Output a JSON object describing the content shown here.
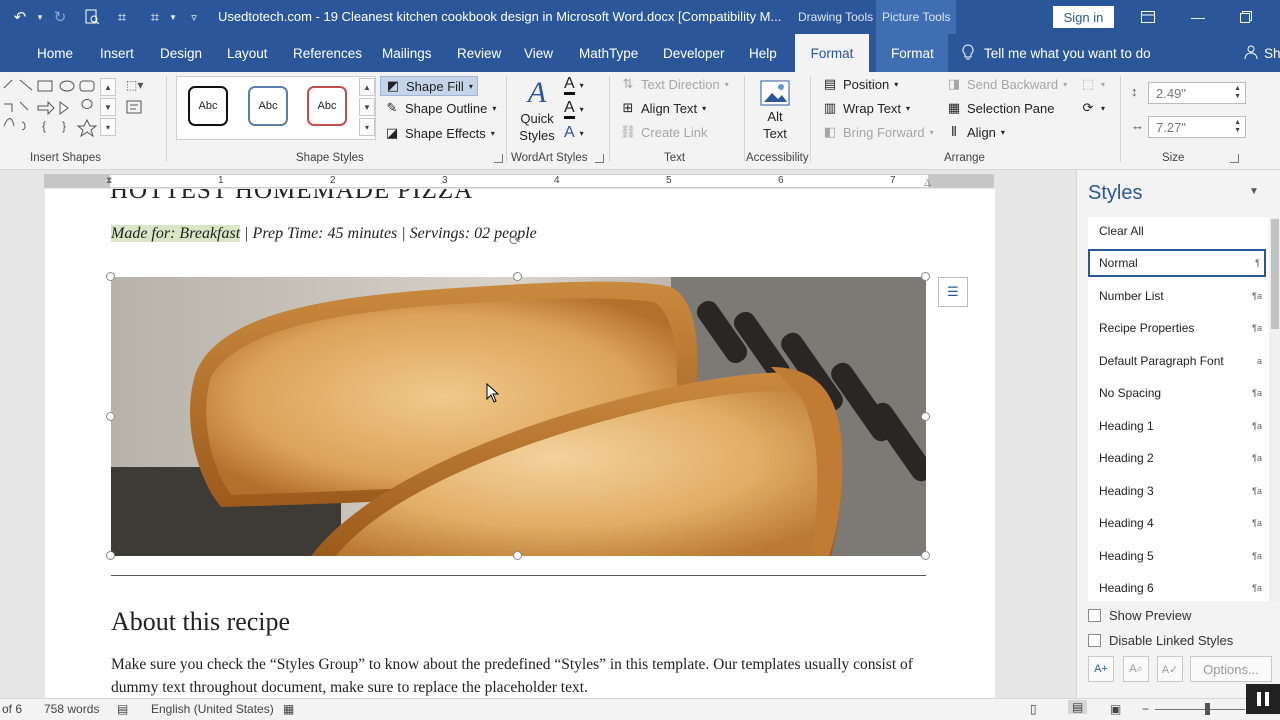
{
  "title_bar": {
    "title": "Usedtotech.com - 19 Cleanest kitchen cookbook design in Microsoft Word.docx [Compatibility M...",
    "context_drawing": "Drawing Tools",
    "context_picture": "Picture Tools",
    "sign_in": "Sign in"
  },
  "tabs": [
    "Home",
    "Insert",
    "Design",
    "Layout",
    "References",
    "Mailings",
    "Review",
    "View",
    "MathType",
    "Developer",
    "Help",
    "Format",
    "Format"
  ],
  "tell_me": "Tell me what you want to do",
  "share": "Sh",
  "ribbon": {
    "insert_shapes_label": "Insert Shapes",
    "shape_styles_label": "Shape Styles",
    "abc_samples": [
      "Abc",
      "Abc",
      "Abc"
    ],
    "shape_fill": "Shape Fill",
    "shape_outline": "Shape Outline",
    "shape_effects": "Shape Effects",
    "quick_styles": "Quick Styles",
    "wordart_label": "WordArt Styles",
    "text_direction": "Text Direction",
    "align_text": "Align Text",
    "create_link": "Create Link",
    "text_label": "Text",
    "alt_text": "Alt Text",
    "accessibility_label": "Accessibility",
    "position": "Position",
    "wrap_text": "Wrap Text",
    "bring_forward": "Bring Forward",
    "send_backward": "Send Backward",
    "selection_pane": "Selection Pane",
    "align": "Align",
    "arrange_label": "Arrange",
    "height_value": "2.49\"",
    "width_value": "7.27\"",
    "size_label": "Size"
  },
  "ruler_numbers": [
    "1",
    "2",
    "3",
    "4",
    "5",
    "6",
    "7"
  ],
  "document": {
    "heading": "HOTTEST HOMEMADE PIZZA",
    "meta_highlight": "Made for: Breakfast",
    "meta_rest": " | Prep Time: 45 minutes | Servings: 02 people",
    "about_heading": "About this recipe",
    "about_body": "Make sure you check the “Styles Group” to know about the predefined “Styles” in this template. Our templates usually consist of dummy text throughout document, make sure to replace the placeholder text."
  },
  "styles_pane": {
    "title": "Styles",
    "items": [
      {
        "label": "Clear All",
        "mark": ""
      },
      {
        "label": "Normal",
        "mark": "¶"
      },
      {
        "label": "Number List",
        "mark": "¶a"
      },
      {
        "label": "Recipe Properties",
        "mark": "¶a"
      },
      {
        "label": "Default Paragraph Font",
        "mark": "a"
      },
      {
        "label": "No Spacing",
        "mark": "¶a"
      },
      {
        "label": "Heading 1",
        "mark": "¶a"
      },
      {
        "label": "Heading 2",
        "mark": "¶a"
      },
      {
        "label": "Heading 3",
        "mark": "¶a"
      },
      {
        "label": "Heading 4",
        "mark": "¶a"
      },
      {
        "label": "Heading 5",
        "mark": "¶a"
      },
      {
        "label": "Heading 6",
        "mark": "¶a"
      }
    ],
    "show_preview": "Show Preview",
    "disable_linked": "Disable Linked Styles",
    "options": "Options..."
  },
  "status_bar": {
    "page": "of 6",
    "words": "758 words",
    "language": "English (United States)"
  },
  "colors": {
    "accent": "#2b579a",
    "highlight": "#d8e6c6"
  }
}
